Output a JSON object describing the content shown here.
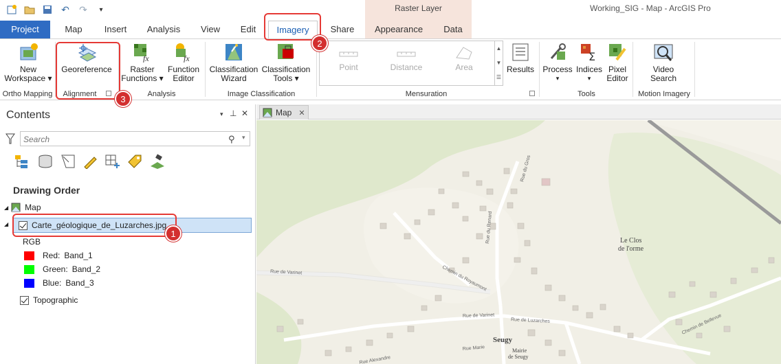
{
  "window": {
    "title": "Working_SIG - Map - ArcGIS Pro",
    "contextual_tab_group": "Raster Layer"
  },
  "quick_access": [
    "new-project-icon",
    "open-folder-icon",
    "save-icon",
    "undo-icon",
    "redo-icon",
    "customize-icon"
  ],
  "tabs": [
    {
      "label": "Project"
    },
    {
      "label": "Map"
    },
    {
      "label": "Insert"
    },
    {
      "label": "Analysis"
    },
    {
      "label": "View"
    },
    {
      "label": "Edit"
    },
    {
      "label": "Imagery"
    },
    {
      "label": "Share"
    },
    {
      "label": "Appearance"
    },
    {
      "label": "Data"
    }
  ],
  "ribbon": {
    "ortho_mapping": {
      "group": "Ortho Mapping",
      "new_workspace_1": "New",
      "new_workspace_2": "Workspace ▾"
    },
    "alignment": {
      "group": "Alignment",
      "georeference": "Georeference"
    },
    "analysis": {
      "group": "Analysis",
      "raster_functions_1": "Raster",
      "raster_functions_2": "Functions ▾",
      "function_editor_1": "Function",
      "function_editor_2": "Editor"
    },
    "image_classification": {
      "group": "Image Classification",
      "wizard_1": "Classification",
      "wizard_2": "Wizard",
      "tools_1": "Classification",
      "tools_2": "Tools ▾"
    },
    "mensuration": {
      "group": "Mensuration",
      "point": "Point",
      "distance": "Distance",
      "area": "Area",
      "results": "Results"
    },
    "tools": {
      "group": "Tools",
      "process": "Process",
      "indices": "Indices",
      "pixel_editor_1": "Pixel",
      "pixel_editor_2": "Editor"
    },
    "motion_imagery": {
      "group": "Motion Imagery",
      "video_search_1": "Video",
      "video_search_2": "Search"
    }
  },
  "contents": {
    "title": "Contents",
    "search_placeholder": "Search",
    "drawing_order": "Drawing Order",
    "map_label": "Map",
    "layer_name": "Carte_géologique_de_Luzarches.jpg",
    "rgb_label": "RGB",
    "bands": [
      {
        "label": "Red:",
        "band": "Band_1",
        "color": "#ff0000"
      },
      {
        "label": "Green:",
        "band": "Band_2",
        "color": "#00ff00"
      },
      {
        "label": "Blue:",
        "band": "Band_3",
        "color": "#0000ff"
      }
    ],
    "basemap_label": "Topographic"
  },
  "map": {
    "tab_label": "Map",
    "place_labels": {
      "le_clos": "Le Clos",
      "de_lorme": "de l'orme",
      "seugy": "Seugy",
      "mairie_1": "Mairie",
      "mairie_2": "de Seugy"
    },
    "street_labels": {
      "rue_varinet": "Rue de Varinet",
      "chemin_royaumont": "Chemin du Royaumont",
      "rue_gros": "Rue du Gros",
      "rue_renard": "Rue du Renard",
      "rue_varinet2": "Rue de Varinet",
      "rue_luzarches": "Rue de Luzarches",
      "chemin_bellevue": "Chemin de Bellevue",
      "rue_alexandre": "Rue Alexandre",
      "rue_marie": "Rue Marie"
    }
  },
  "annotations": {
    "one": "1",
    "two": "2",
    "three": "3"
  },
  "colors": {
    "project_tab": "#2f6cc3",
    "highlight": "#e53935",
    "selection": "#cfe3f7"
  }
}
